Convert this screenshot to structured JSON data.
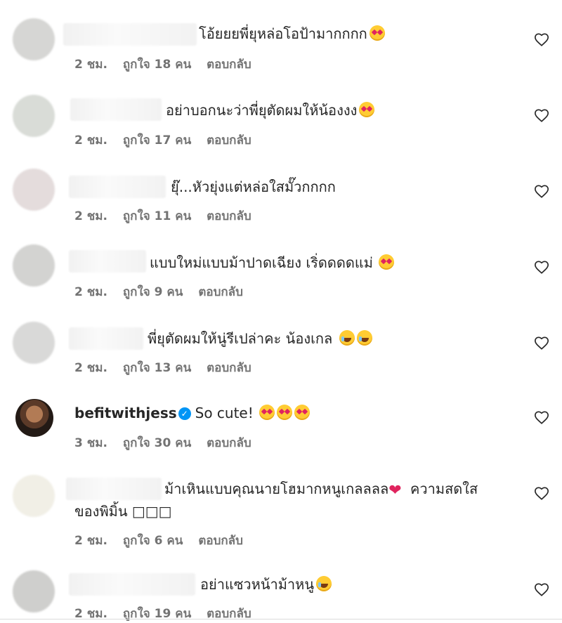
{
  "comments": [
    {
      "text": "โอ้ยยยพี่ยุหล่อโอป้ามากกกก",
      "emoji": [
        "heart"
      ],
      "time": "2 ชม.",
      "likes": "ถูกใจ 18 คน",
      "reply": "ตอบกลับ"
    },
    {
      "text": "อย่าบอกนะว่าพี่ยุตัดผมให้น้องงง",
      "emoji": [
        "heart"
      ],
      "time": "2 ชม.",
      "likes": "ถูกใจ 17 คน",
      "reply": "ตอบกลับ"
    },
    {
      "text": "ยุ๊...หัวยุ่งแต่หล่อใสมั๊วกกกก",
      "emoji": [],
      "time": "2 ชม.",
      "likes": "ถูกใจ 11 คน",
      "reply": "ตอบกลับ"
    },
    {
      "text": "แบบใหม่แบบม้าปาดเฉียง เริ่ดดดดแม่",
      "emoji": [
        "heart"
      ],
      "time": "2 ชม.",
      "likes": "ถูกใจ 9 คน",
      "reply": "ตอบกลับ"
    },
    {
      "text": "พี่ยุตัดผมให้นู่รีเปล่าคะ น้องเกล",
      "emoji": [
        "laugh",
        "laugh"
      ],
      "time": "2 ชม.",
      "likes": "ถูกใจ 13 คน",
      "reply": "ตอบกลับ"
    },
    {
      "username": "befitwithjess",
      "text": "So cute!",
      "emoji": [
        "heart",
        "heart",
        "heart"
      ],
      "time": "3 ชม.",
      "likes": "ถูกใจ 30 คน",
      "reply": "ตอบกลับ"
    },
    {
      "text": "ม้าเหินแบบคุณนายโฮมากหนูเกลลลล",
      "text2": "ความสดใส",
      "text3": "ของพิมิ้น □□□",
      "time": "2 ชม.",
      "likes": "ถูกใจ 6 คน",
      "reply": "ตอบกลับ"
    },
    {
      "text": "อย่าแซวหน้าม้าหนู",
      "emoji": [
        "laugh"
      ],
      "time": "2 ชม.",
      "likes": "ถูกใจ 19 คน",
      "reply": "ตอบกลับ"
    }
  ],
  "icons": {
    "like": "heart-outline-icon",
    "verified": "verified-badge-icon"
  },
  "colors": {
    "meta": "#737373",
    "verified": "#0095f6",
    "heart": "#e0245e"
  }
}
